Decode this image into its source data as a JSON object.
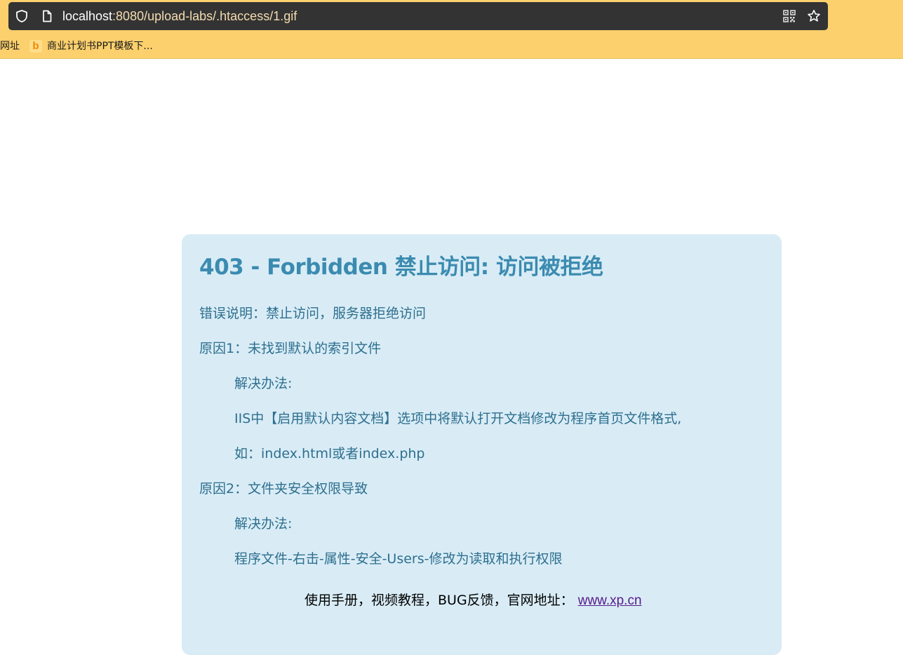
{
  "browser": {
    "url_host": "localhost",
    "url_path": ":8080/upload-labs/.htaccess/1.gif",
    "bookmarks": [
      {
        "label": "网址"
      },
      {
        "label": "商业计划书PPT模板下..."
      }
    ],
    "bookmark_favicon": "b"
  },
  "error": {
    "title": "403 - Forbidden 禁止访问: 访问被拒绝",
    "description": "错误说明：禁止访问，服务器拒绝访问",
    "reason1": "原因1：未找到默认的索引文件",
    "solution1_label": "解决办法:",
    "solution1_step1": "IIS中【启用默认内容文档】选项中将默认打开文档修改为程序首页文件格式,",
    "solution1_step2": "如：index.html或者index.php",
    "reason2": "原因2：文件夹安全权限导致",
    "solution2_label": "解决办法:",
    "solution2_step1": "程序文件-右击-属性-安全-Users-修改为读取和执行权限",
    "footer_text": "使用手册，视频教程，BUG反馈，官网地址：",
    "footer_link": "www.xp.cn"
  },
  "colors": {
    "chrome_bg": "#fbd06d",
    "urlbar_bg": "#333333",
    "box_bg": "#d9ecf6",
    "title_color": "#3b8bb0",
    "text_color": "#2e6f8e",
    "link_color": "#551a8b"
  }
}
